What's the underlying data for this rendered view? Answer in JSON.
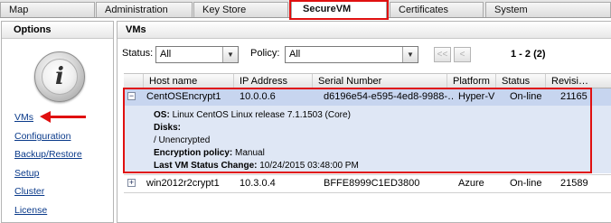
{
  "tabs": [
    {
      "label": "Map",
      "active": false
    },
    {
      "label": "Administration",
      "active": false
    },
    {
      "label": "Key Store",
      "active": false
    },
    {
      "label": "SecureVM",
      "active": true
    },
    {
      "label": "Certificates",
      "active": false
    },
    {
      "label": "System",
      "active": false
    }
  ],
  "options": {
    "title": "Options",
    "icon": "info-icon",
    "icon_glyph": "i",
    "links": [
      "VMs",
      "Configuration",
      "Backup/Restore",
      "Setup",
      "Cluster",
      "License"
    ]
  },
  "vms": {
    "title": "VMs",
    "status_label": "Status:",
    "status_value": "All",
    "policy_label": "Policy:",
    "policy_value": "All",
    "pager_first": "<<",
    "pager_prev": "<",
    "range": "1 - 2 (2)",
    "columns": [
      "Host name",
      "IP Address",
      "Serial Number",
      "Platform",
      "Status",
      "Revisi…"
    ],
    "rows": [
      {
        "expander": "−",
        "host": "CentOSEncrypt1",
        "ip": "10.0.0.6",
        "serial": "d6196e54-e595-4ed8-9988-…",
        "platform": "Hyper-V",
        "status": "On-line",
        "revision": "21165",
        "details": {
          "os_label": "OS:",
          "os_value": "Linux CentOS Linux release 7.1.1503 (Core)",
          "disks_label": "Disks:",
          "disks_value": "/ Unencrypted",
          "policy_label": "Encryption policy:",
          "policy_value": "Manual",
          "last_change_label": "Last VM Status Change:",
          "last_change_value": "10/24/2015 03:48:00 PM"
        }
      },
      {
        "expander": "+",
        "host": "win2012r2crypt1",
        "ip": "10.3.0.4",
        "serial": "BFFE8999C1ED3800",
        "platform": "Azure",
        "status": "On-line",
        "revision": "21589"
      }
    ]
  },
  "colors": {
    "highlight": "#e01010",
    "selected_row": "#c7d5ef",
    "details_bg": "#dfe7f5",
    "link": "#0a3a8a"
  }
}
